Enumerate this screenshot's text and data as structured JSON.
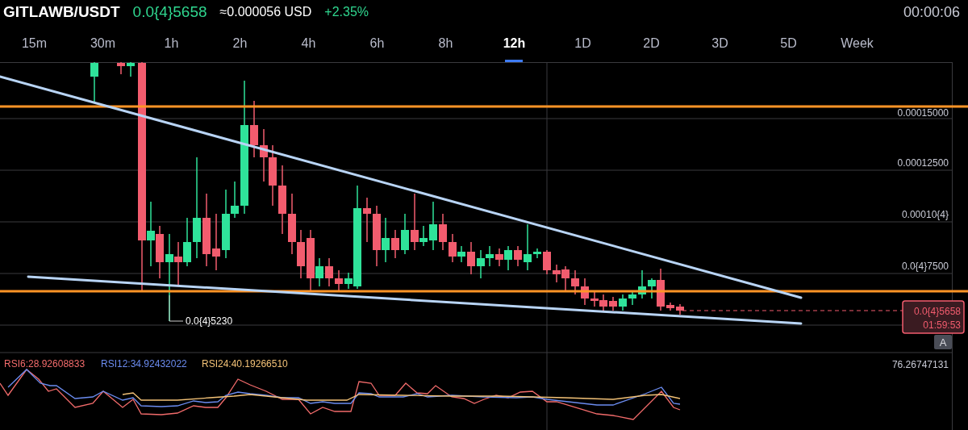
{
  "header": {
    "pair": "GITLAWB/USDT",
    "price": "0.0{4}5658",
    "usd": "≈0.000056 USD",
    "change": "+2.35%",
    "clock": "00:00:06"
  },
  "intervals": [
    {
      "label": "15m",
      "selected": false
    },
    {
      "label": "30m",
      "selected": false
    },
    {
      "label": "1h",
      "selected": false
    },
    {
      "label": "2h",
      "selected": false
    },
    {
      "label": "4h",
      "selected": false
    },
    {
      "label": "6h",
      "selected": false
    },
    {
      "label": "8h",
      "selected": false
    },
    {
      "label": "12h",
      "selected": true
    },
    {
      "label": "1D",
      "selected": false
    },
    {
      "label": "2D",
      "selected": false
    },
    {
      "label": "3D",
      "selected": false
    },
    {
      "label": "5D",
      "selected": false
    },
    {
      "label": "Week",
      "selected": false
    }
  ],
  "price_axis": [
    "0.00015000",
    "0.00012500",
    "0.00010{4}",
    "0.0{4}7500"
  ],
  "low_marker": "0.0{4}5230",
  "last_price": {
    "price": "0.0{4}5658",
    "countdown": "01:59:53"
  },
  "alert_button": "A",
  "rsi": {
    "legend": [
      {
        "label": "RSI6:28.92608833",
        "color": "#f26b6b"
      },
      {
        "label": "RSI12:34.92432022",
        "color": "#6b8cf0"
      },
      {
        "label": "RSI24:40.19266510",
        "color": "#f3c277"
      }
    ],
    "axis_label": "76.26747131"
  }
}
